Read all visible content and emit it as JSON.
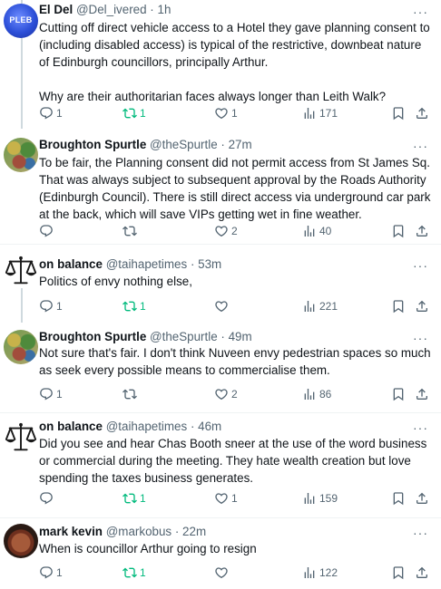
{
  "accent": {
    "retweet_active": "#00ba7c",
    "muted": "#536471",
    "text": "#0f1419"
  },
  "posts": [
    {
      "avatar_icon": "pleb-avatar",
      "avatar_text": "PLEB",
      "name": "El Del",
      "handle": "@Del_ivered",
      "time": "1h",
      "more": "···",
      "text": [
        "Cutting off direct vehicle access to a Hotel they gave planning consent to (including disabled access) is typical of the restrictive, downbeat nature of Edinburgh councillors, principally Arthur.",
        "Why are their authoritarian faces always longer than Leith Walk?"
      ],
      "replies": "1",
      "retweets": "1",
      "likes": "1",
      "views": "171"
    },
    {
      "avatar_icon": "spurtle-avatar",
      "name": "Broughton Spurtle",
      "handle": "@theSpurtle",
      "time": "27m",
      "more": "···",
      "text": [
        "To be fair, the Planning consent did not permit access from St James Sq. That was always subject to subsequent approval by the Roads Authority (Edinburgh Council). There is still direct access via underground car park at the back, which will save VIPs getting wet in fine weather."
      ],
      "replies": "",
      "retweets": "",
      "likes": "2",
      "views": "40"
    },
    {
      "avatar_icon": "scales-avatar",
      "name": "on balance",
      "handle": "@taihapetimes",
      "time": "53m",
      "more": "···",
      "text": [
        "Politics of envy nothing else,"
      ],
      "replies": "1",
      "retweets": "1",
      "likes": "",
      "views": "221"
    },
    {
      "avatar_icon": "spurtle-avatar",
      "name": "Broughton Spurtle",
      "handle": "@theSpurtle",
      "time": "49m",
      "more": "···",
      "text": [
        "Not sure that's fair. I don't think Nuveen envy pedestrian spaces so much as seek every possible means to commercialise them."
      ],
      "replies": "1",
      "retweets": "",
      "likes": "2",
      "views": "86"
    },
    {
      "avatar_icon": "scales-avatar",
      "name": "on balance",
      "handle": "@taihapetimes",
      "time": "46m",
      "more": "···",
      "text": [
        "Did you see and hear Chas Booth sneer at the use of the word business or commercial during the meeting. They hate wealth creation but love spending the taxes business generates."
      ],
      "replies": "",
      "retweets": "1",
      "likes": "1",
      "views": "159"
    },
    {
      "avatar_icon": "kevin-avatar",
      "name": "mark kevin",
      "handle": "@markobus",
      "time": "22m",
      "more": "···",
      "text": [
        "When is councillor Arthur going to resign"
      ],
      "replies": "1",
      "retweets": "1",
      "likes": "",
      "views": "122"
    }
  ]
}
